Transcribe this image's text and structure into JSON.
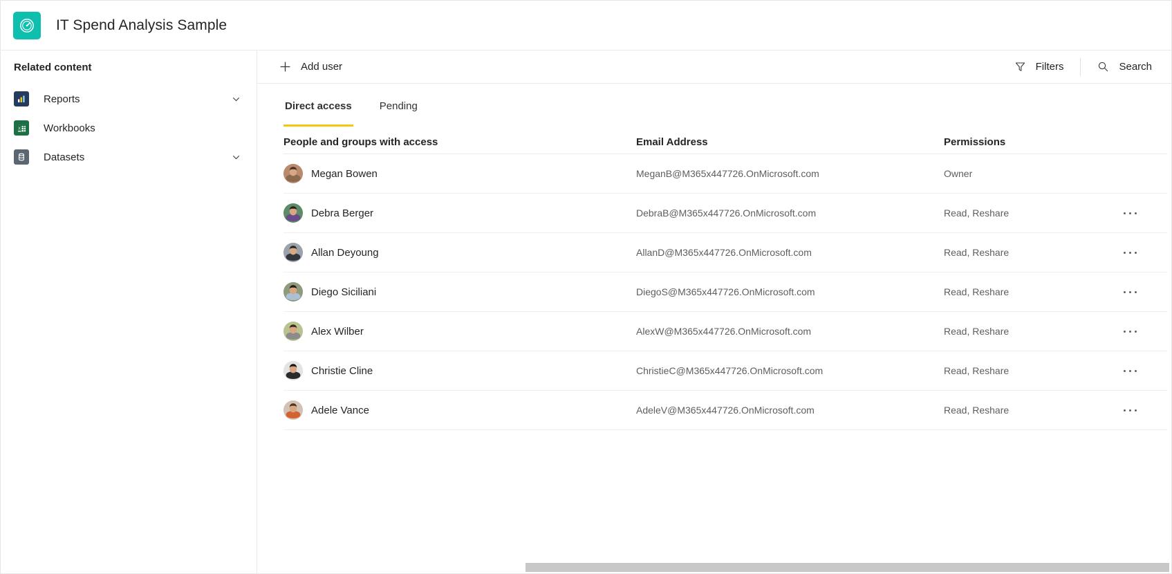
{
  "header": {
    "title": "IT Spend Analysis Sample",
    "icon": "gauge-icon",
    "icon_color": "#0FBFAE"
  },
  "sidebar": {
    "title": "Related content",
    "items": [
      {
        "label": "Reports",
        "icon": "reports-icon",
        "icon_color": "#243a5e",
        "has_chevron": true
      },
      {
        "label": "Workbooks",
        "icon": "workbooks-icon",
        "icon_color": "#1d7044",
        "has_chevron": false
      },
      {
        "label": "Datasets",
        "icon": "datasets-icon",
        "icon_color": "#5c6670",
        "has_chevron": true
      }
    ]
  },
  "toolbar": {
    "add_user_label": "Add user",
    "add_user_icon": "plus-icon",
    "filters_label": "Filters",
    "filters_icon": "funnel-icon",
    "search_label": "Search",
    "search_icon": "search-icon"
  },
  "tabs": [
    {
      "label": "Direct access",
      "active": true
    },
    {
      "label": "Pending",
      "active": false
    }
  ],
  "table": {
    "columns": {
      "name": "People and groups with access",
      "email": "Email Address",
      "permissions": "Permissions"
    },
    "rows": [
      {
        "name": "Megan Bowen",
        "email": "MeganB@M365x447726.OnMicrosoft.com",
        "permissions": "Owner",
        "has_more": false,
        "avatar_bg": "#b98a6e",
        "avatar_hair": "#4a3226",
        "avatar_shirt": "#8c6a4f"
      },
      {
        "name": "Debra Berger",
        "email": "DebraB@M365x447726.OnMicrosoft.com",
        "permissions": "Read, Reshare",
        "has_more": true,
        "avatar_bg": "#5e8c6a",
        "avatar_hair": "#2b2220",
        "avatar_shirt": "#6b4a8c"
      },
      {
        "name": "Allan Deyoung",
        "email": "AllanD@M365x447726.OnMicrosoft.com",
        "permissions": "Read, Reshare",
        "has_more": true,
        "avatar_bg": "#9aa3ab",
        "avatar_hair": "#2a2a2a",
        "avatar_shirt": "#33373d"
      },
      {
        "name": "Diego Siciliani",
        "email": "DiegoS@M365x447726.OnMicrosoft.com",
        "permissions": "Read, Reshare",
        "has_more": true,
        "avatar_bg": "#8d9a7c",
        "avatar_hair": "#241d18",
        "avatar_shirt": "#a9c0d6"
      },
      {
        "name": "Alex Wilber",
        "email": "AlexW@M365x447726.OnMicrosoft.com",
        "permissions": "Read, Reshare",
        "has_more": true,
        "avatar_bg": "#b7c48f",
        "avatar_hair": "#3a2a1e",
        "avatar_shirt": "#8b8b8b"
      },
      {
        "name": "Christie Cline",
        "email": "ChristieC@M365x447726.OnMicrosoft.com",
        "permissions": "Read, Reshare",
        "has_more": true,
        "avatar_bg": "#e3e3e3",
        "avatar_hair": "#1e1814",
        "avatar_shirt": "#2b2b2b"
      },
      {
        "name": "Adele Vance",
        "email": "AdeleV@M365x447726.OnMicrosoft.com",
        "permissions": "Read, Reshare",
        "has_more": true,
        "avatar_bg": "#d3c3b4",
        "avatar_hair": "#4a3526",
        "avatar_shirt": "#d4622e"
      }
    ]
  },
  "scrollbar": {
    "orientation": "horizontal",
    "color": "#c8c8c8"
  }
}
